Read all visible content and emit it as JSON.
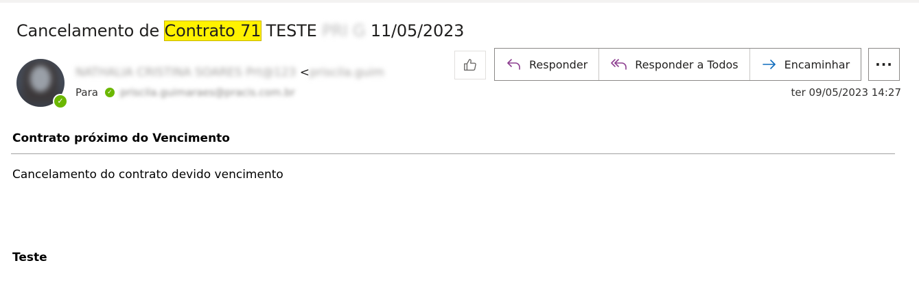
{
  "email": {
    "subject": {
      "before": "Cancelamento de ",
      "highlight": "Contrato 71",
      "middle": " TESTE ",
      "redacted": "PRI G",
      "after": " 11/05/2023"
    },
    "sender": {
      "name": "NATHALIA CRISTINA SOARES Prt@123",
      "lt": " <",
      "email_partial": "priscila.guim"
    },
    "to": {
      "label": "Para",
      "address": "priscila.guimaraes@pracis.com.br"
    },
    "date": "ter 09/05/2023 14:27",
    "presence_color": "#6bb700"
  },
  "actions": {
    "like_icon": "thumbs-up-icon",
    "reply": "Responder",
    "reply_all": "Responder a Todos",
    "forward": "Encaminhar",
    "more": "···"
  },
  "body": {
    "heading": "Contrato próximo do Vencimento",
    "paragraph": "Cancelamento do contrato devido vencimento",
    "footer_heading": "Teste"
  }
}
